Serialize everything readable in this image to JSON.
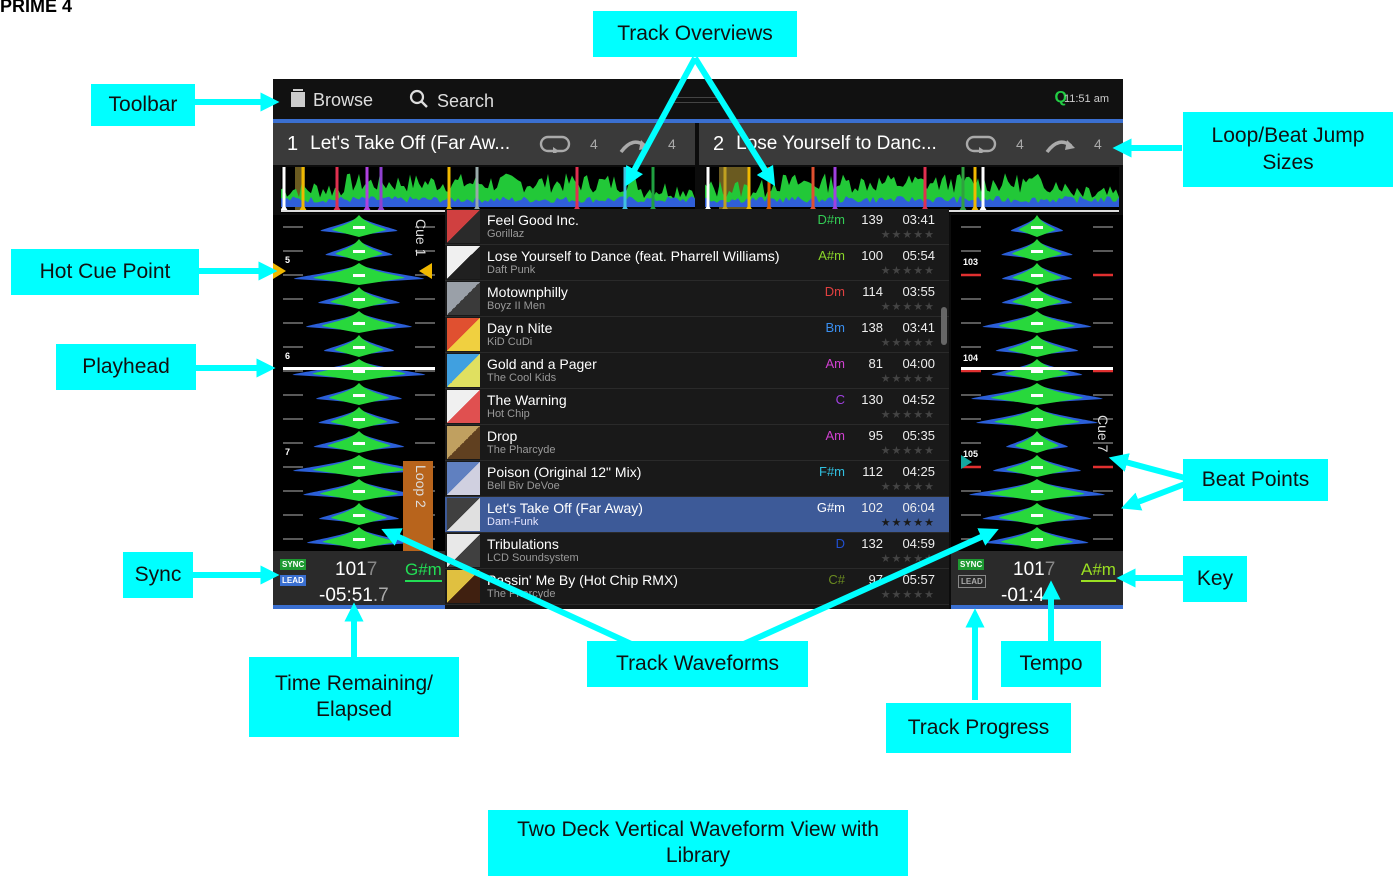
{
  "page_label": "PRIME 4",
  "callouts": {
    "toolbar": "Toolbar",
    "track_overviews": "Track Overviews",
    "loop_beat_jump": "Loop/Beat Jump Sizes",
    "hot_cue_point": "Hot Cue Point",
    "playhead": "Playhead",
    "beat_points": "Beat Points",
    "sync": "Sync",
    "key": "Key",
    "track_waveforms": "Track Waveforms",
    "tempo": "Tempo",
    "time_remaining": "Time Remaining/ Elapsed",
    "track_progress": "Track Progress",
    "view_name": "Two Deck Vertical Waveform View with Library"
  },
  "toolbar": {
    "browse_label": "Browse",
    "search_label": "Search",
    "quantize": "Q",
    "clock": "11:51 am",
    "browse_icon": "folder-icon",
    "search_icon": "search-icon"
  },
  "deck1": {
    "number": "1",
    "title": "Let's Take Off (Far Aw...",
    "loop_size": "4",
    "jump_size": "4",
    "cue_label": "Cue 1",
    "loop_label": "Loop 2",
    "cue_numbers": [
      "5",
      "6",
      "7"
    ],
    "sync_label": "SYNC",
    "lead_label": "LEAD",
    "bpm_main": "101",
    "bpm_dim": "7",
    "key": "G#m",
    "time": "-05:51",
    "time_dim": ".7"
  },
  "deck2": {
    "number": "2",
    "title": "Lose Yourself to Danc...",
    "loop_size": "4",
    "jump_size": "4",
    "cue_label": "Cue 7",
    "beat_numbers": [
      "103",
      "104",
      "105"
    ],
    "sync_label": "SYNC",
    "lead_label": "LEAD",
    "bpm_main": "101",
    "bpm_dim": "7",
    "key": "A#m",
    "time": "-01:4",
    "time_dim": "4"
  },
  "library": {
    "rows": [
      {
        "title": "Feel Good Inc.",
        "artist": "Gorillaz",
        "key": "D#m",
        "key_color": "#33cc55",
        "bpm": "139",
        "time": "03:41",
        "stars": "★★★★★",
        "art": [
          "#d04040",
          "#2a2a2a"
        ]
      },
      {
        "title": "Lose Yourself to Dance (feat. Pharrell Williams)",
        "artist": "Daft Punk",
        "key": "A#m",
        "key_color": "#8ad62a",
        "bpm": "100",
        "time": "05:54",
        "stars": "★★★★★",
        "art": [
          "#f0f0f0",
          "#202020"
        ]
      },
      {
        "title": "Motownphilly",
        "artist": "Boyz II Men",
        "key": "Dm",
        "key_color": "#e04040",
        "bpm": "114",
        "time": "03:55",
        "stars": "★★★★★",
        "art": [
          "#9aa0a8",
          "#3a3a3a"
        ]
      },
      {
        "title": "Day n Nite",
        "artist": "KiD CuDi",
        "key": "Bm",
        "key_color": "#3a8ff0",
        "bpm": "138",
        "time": "03:41",
        "stars": "★★★★★",
        "art": [
          "#e05030",
          "#f0d040"
        ]
      },
      {
        "title": "Gold and a Pager",
        "artist": "The Cool Kids",
        "key": "Am",
        "key_color": "#d040d0",
        "bpm": "81",
        "time": "04:00",
        "stars": "★★★★★",
        "art": [
          "#40a0e0",
          "#e0e060"
        ]
      },
      {
        "title": "The Warning",
        "artist": "Hot Chip",
        "key": "C",
        "key_color": "#a040e0",
        "bpm": "130",
        "time": "04:52",
        "stars": "★★★★★",
        "art": [
          "#f0f0f0",
          "#e05050"
        ]
      },
      {
        "title": "Drop",
        "artist": "The Pharcyde",
        "key": "Am",
        "key_color": "#d040d0",
        "bpm": "95",
        "time": "05:35",
        "stars": "★★★★★",
        "art": [
          "#c0a060",
          "#604020"
        ]
      },
      {
        "title": "Poison (Original 12\" Mix)",
        "artist": "Bell Biv DeVoe",
        "key": "F#m",
        "key_color": "#30c0e0",
        "bpm": "112",
        "time": "04:25",
        "stars": "★★★★★",
        "art": [
          "#6080c0",
          "#d0d0e0"
        ]
      },
      {
        "title": "Let's Take Off (Far Away)",
        "artist": "Dam-Funk",
        "key": "G#m",
        "key_color": "#ffffff",
        "bpm": "102",
        "time": "06:04",
        "stars": "★★★★★",
        "art": [
          "#404040",
          "#e0e0e0"
        ]
      },
      {
        "title": "Tribulations",
        "artist": "LCD Soundsystem",
        "key": "D",
        "key_color": "#2050d0",
        "bpm": "132",
        "time": "04:59",
        "stars": "★★★★★",
        "art": [
          "#e8e8e8",
          "#404040"
        ]
      },
      {
        "title": "Passin' Me By (Hot Chip RMX)",
        "artist": "The Pharcyde",
        "key": "C#",
        "key_color": "#6a8a20",
        "bpm": "97",
        "time": "05:57",
        "stars": "★★★★★",
        "art": [
          "#e0c040",
          "#402010"
        ]
      }
    ]
  },
  "colors": {
    "callout": "#00ffff",
    "accent_blue": "#3a6fd0",
    "waveform_green": "#28d83c",
    "waveform_blue": "#2b5fd8",
    "loop_orange": "#b8641c",
    "cue_yellow": "#f0b800"
  }
}
